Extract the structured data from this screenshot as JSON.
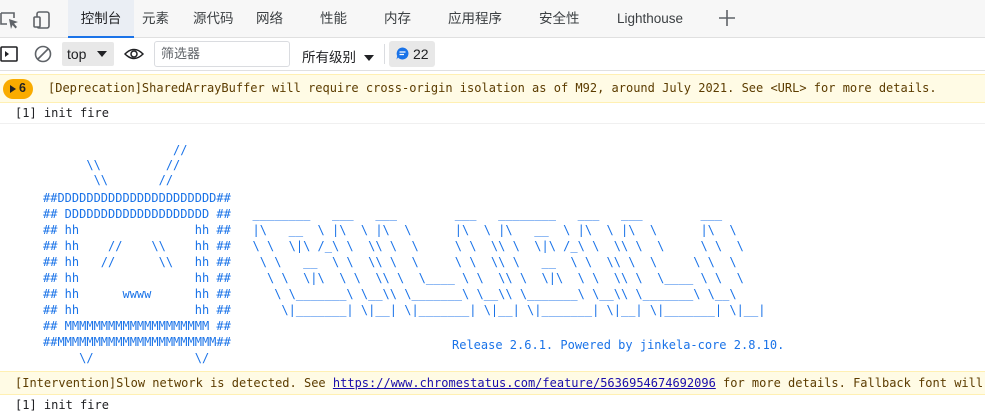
{
  "tabs": [
    {
      "label": "控制台",
      "active": true
    },
    {
      "label": "元素"
    },
    {
      "label": "源代码"
    },
    {
      "label": "网络"
    },
    {
      "label": "性能"
    },
    {
      "label": "内存"
    },
    {
      "label": "应用程序"
    },
    {
      "label": "安全性"
    },
    {
      "label": "Lighthouse"
    }
  ],
  "toolbar": {
    "context": "top",
    "filter_placeholder": "筛选器",
    "levels": "所有级别",
    "message_count": "22"
  },
  "console": {
    "warning_count": "6",
    "deprecation": "[Deprecation]SharedArrayBuffer will require cross-origin isolation as of M92, around July 2021. See <URL> for more details.",
    "log1": "[1] init fire",
    "ascii_art": [
      "                  //",
      "      \\\\         //",
      "       \\\\       //",
      "##DDDDDDDDDDDDDDDDDDDDDD##",
      "## DDDDDDDDDDDDDDDDDDDD ##   ________   ___   ___        ___   ________   ___   ___        ___",
      "## hh                hh ##   |\\   __  \\ |\\  \\ |\\  \\      |\\  \\ |\\   __  \\ |\\  \\ |\\  \\      |\\  \\",
      "## hh    //    \\\\    hh ##   \\ \\  \\|\\ /_\\ \\  \\\\ \\  \\     \\ \\  \\\\ \\  \\|\\ /_\\ \\  \\\\ \\  \\     \\ \\  \\",
      "## hh   //      \\\\   hh ##    \\ \\   __  \\ \\  \\\\ \\  \\     \\ \\  \\\\ \\   __  \\ \\  \\\\ \\  \\     \\ \\  \\",
      "## hh                hh ##     \\ \\  \\|\\  \\ \\  \\\\ \\  \\____ \\ \\  \\\\ \\  \\|\\  \\ \\  \\\\ \\  \\____ \\ \\  \\",
      "## hh      wwww      hh ##      \\ \\_______\\ \\__\\\\ \\_______\\ \\__\\\\ \\_______\\ \\__\\\\ \\_______\\ \\__\\",
      "## hh                hh ##       \\|_______| \\|__| \\|_______| \\|__| \\|_______| \\|__| \\|_______| \\|__|",
      "## MMMMMMMMMMMMMMMMMMMM ##",
      "##MMMMMMMMMMMMMMMMMMMMMM##",
      "     \\/              \\/"
    ],
    "release": "Release 2.6.1. Powered by jinkela-core 2.8.10.",
    "intervention_prefix": "[Intervention]Slow network is detected. See ",
    "intervention_link": "https://www.chromestatus.com/feature/5636954674692096",
    "intervention_suffix": " for more details. Fallback font will be used while loading",
    "log2": "[1] init fire"
  }
}
